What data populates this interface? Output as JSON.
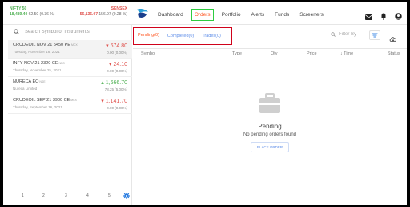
{
  "indices": {
    "nifty": {
      "name": "NIFTY 50",
      "value": "18,489.40",
      "change": "62.50 (0.36 %)"
    },
    "sensex": {
      "name": "SENSEX",
      "value": "56,136.07",
      "change": "156.97 (0.28 %)"
    }
  },
  "nav": {
    "items": [
      "Dashboard",
      "Orders",
      "Portfolio",
      "Alerts",
      "Funds",
      "Screeners"
    ],
    "active": "Orders"
  },
  "icons": {
    "mail": "mail-icon",
    "bell": "bell-icon",
    "user": "user-icon",
    "search": "search-icon",
    "filter": "filter-icon",
    "download": "download-icon",
    "settings": "gear-icon",
    "empty": "briefcase-icon"
  },
  "colors": {
    "accent": "#ff5722",
    "up": "#4caf50",
    "down": "#df514c",
    "link": "#5f8ee8",
    "highlight_green": "#2ecc40",
    "highlight_red": "#d0021b"
  },
  "watchlist": {
    "search_placeholder": "Search Symbol or Instruments",
    "items": [
      {
        "symbol": "CRUDEOIL NOV 21 5450 PE",
        "exchange": "MCX",
        "sub": "Tuesday, November 16, 2021",
        "price": "674.80",
        "direction": "down",
        "change": "0.00 (0.00%)"
      },
      {
        "symbol": "INFY NOV 21 2320 CE",
        "exchange": "NFO",
        "sub": "Thursday, November 25, 2021",
        "price": "24.10",
        "direction": "down",
        "change": "0.00 (0.00%)"
      },
      {
        "symbol": "NURECA EQ",
        "exchange": "NSE",
        "sub": "Nureca Limited",
        "price": "1,666.70",
        "direction": "up",
        "change": "78.25 (5.00%)"
      },
      {
        "symbol": "CRUDEOIL SEP 21 3900 CE",
        "exchange": "MCX",
        "sub": "Thursday, September 16, 2021",
        "price": "1,141.70",
        "direction": "down",
        "change": "0.00 (0.00%)"
      }
    ],
    "pages": [
      "1",
      "2",
      "3",
      "4",
      "5"
    ]
  },
  "orders": {
    "tabs": [
      "Pending(0)",
      "Completed(0)",
      "Trades(0)"
    ],
    "active_tab": "Pending(0)",
    "filter_placeholder": "Filter By",
    "columns": [
      "Symbol",
      "Type",
      "Qty",
      "Price",
      "↓ Time",
      "Status"
    ],
    "empty_title": "Pending",
    "empty_message": "No pending orders found",
    "place_order_label": "PLACE ORDER"
  }
}
